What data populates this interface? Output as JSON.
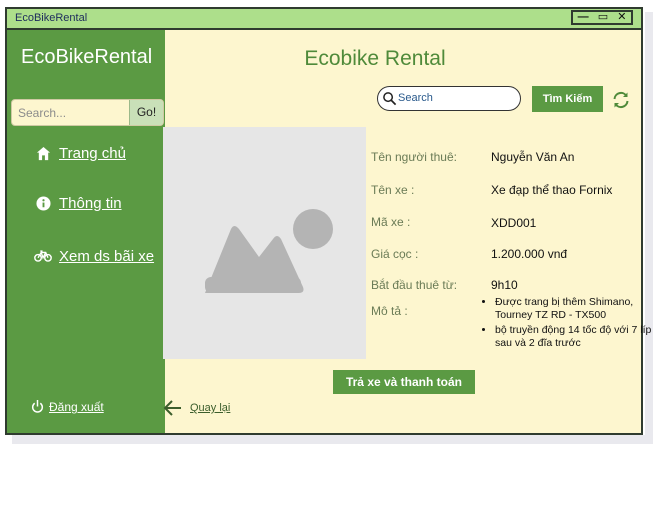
{
  "window": {
    "title": "EcoBikeRental",
    "controls": {
      "minimize": "—",
      "maximize": "▭",
      "close": "✕"
    }
  },
  "sidebar": {
    "brand": "EcoBikeRental",
    "search": {
      "placeholder": "Search...",
      "button": "Go!"
    },
    "items": [
      {
        "label": "Trang chủ",
        "icon": "home-icon"
      },
      {
        "label": "Thông tin",
        "icon": "info-icon"
      },
      {
        "label": "Xem ds bãi xe",
        "icon": "bicycle-icon"
      }
    ],
    "logout": "Đăng xuất"
  },
  "header": {
    "title": "Ecobike Rental",
    "search_placeholder": "Search",
    "search_button": "Tìm Kiếm"
  },
  "details": [
    {
      "label": "Tên người thuê:",
      "value": "Nguyễn Văn An"
    },
    {
      "label": "Tên xe :",
      "value": "Xe đạp thể thao Fornix"
    },
    {
      "label": "Mã xe :",
      "value": "XDD001"
    },
    {
      "label": "Giá cọc :",
      "value": "1.200.000 vnđ"
    },
    {
      "label": "Bắt đầu thuê từ:",
      "value": "9h10"
    }
  ],
  "description": {
    "label": "Mô tả  :",
    "items": [
      "Được trang bị thêm Shimano, Tourney TZ RD - TX500",
      "bộ truyền động 14 tốc độ với 7 líp sau và 2 đĩa trước"
    ]
  },
  "actions": {
    "pay": "Trả xe và thanh toán",
    "back": "Quay lại"
  },
  "colors": {
    "green": "#5b9a43",
    "light_green": "#addf8b",
    "cream": "#fdf6cf"
  }
}
